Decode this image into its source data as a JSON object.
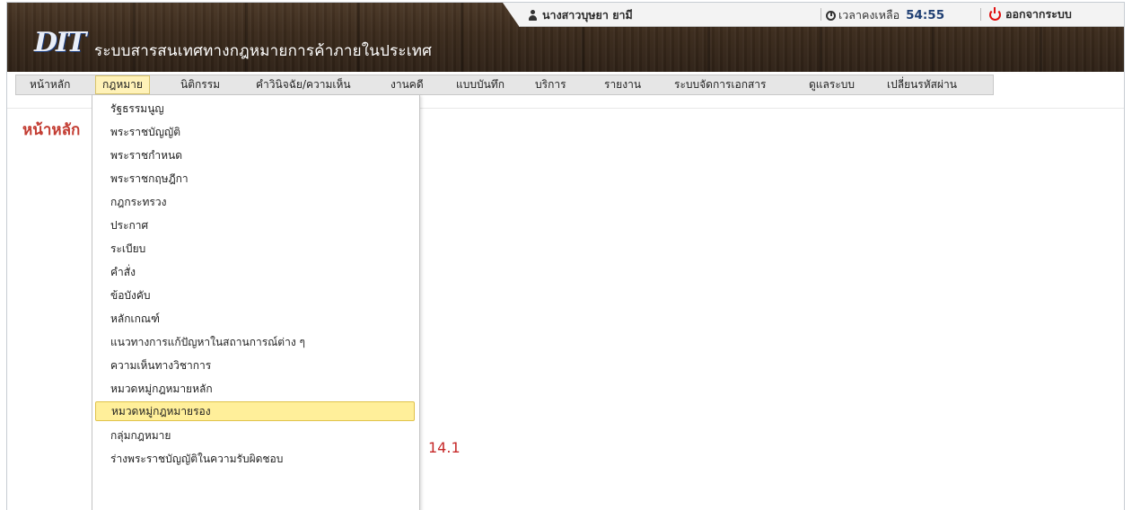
{
  "header": {
    "logo_text": "DIT",
    "system_title": "ระบบสารสนเทศทางกฎหมายการค้าภายในประเทศ"
  },
  "topbar": {
    "user_name": "นางสาวบุษยา ยามี",
    "timer_label": "เวลาคงเหลือ",
    "timer_value": "54:55",
    "logout_label": "ออกจากระบบ"
  },
  "menu": {
    "items": [
      {
        "label": "หน้าหลัก"
      },
      {
        "label": "กฎหมาย",
        "active": true
      },
      {
        "label": "นิติกรรม"
      },
      {
        "label": "คำวินิจฉัย/ความเห็น"
      },
      {
        "label": "งานคดี"
      },
      {
        "label": "แบบบันทึก"
      },
      {
        "label": "บริการ"
      },
      {
        "label": "รายงาน"
      },
      {
        "label": "ระบบจัดการเอกสาร"
      },
      {
        "label": "ดูแลระบบ"
      },
      {
        "label": "เปลี่ยนรหัสผ่าน"
      }
    ]
  },
  "page": {
    "title": "หน้าหลัก"
  },
  "dropdown": {
    "items": [
      {
        "label": "รัฐธรรมนูญ"
      },
      {
        "label": "พระราชบัญญัติ"
      },
      {
        "label": "พระราชกำหนด"
      },
      {
        "label": "พระราชกฤษฎีกา"
      },
      {
        "label": "กฎกระทรวง"
      },
      {
        "label": "ประกาศ"
      },
      {
        "label": "ระเบียบ"
      },
      {
        "label": "คำสั่ง"
      },
      {
        "label": "ข้อบังคับ"
      },
      {
        "label": "หลักเกณฑ์"
      },
      {
        "label": "แนวทางการแก้ปัญหาในสถานการณ์ต่าง ๆ"
      },
      {
        "label": "ความเห็นทางวิชาการ"
      },
      {
        "label": "หมวดหมู่กฎหมายหลัก"
      },
      {
        "label": "หมวดหมู่กฎหมายรอง",
        "highlighted": true
      },
      {
        "label": "กลุ่มกฎหมาย"
      },
      {
        "label": "ร่างพระราชบัญญัติในความรับผิดชอบ"
      }
    ]
  },
  "annotation": {
    "label": "14.1"
  },
  "colors": {
    "header_wood": "#3a2a1c",
    "page_title": "#c33c32",
    "highlight": "#ffef9a",
    "annotation": "#c62828",
    "power": "#e01010"
  }
}
